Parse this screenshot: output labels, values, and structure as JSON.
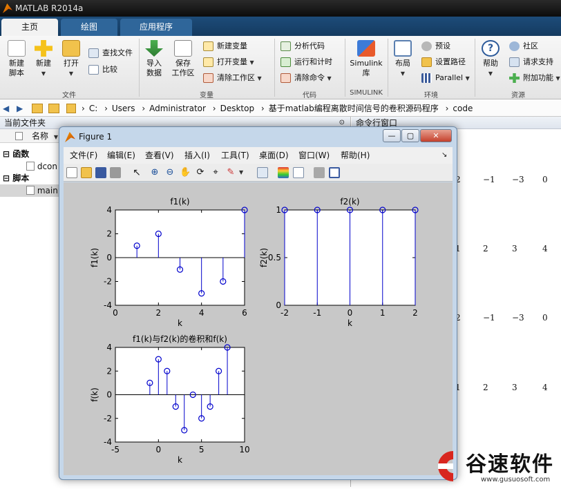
{
  "app": {
    "title": "MATLAB R2014a",
    "tabs": [
      "主页",
      "绘图",
      "应用程序"
    ]
  },
  "ribbon": {
    "file_group": {
      "label": "文件",
      "new_script": "新建\n脚本",
      "new": "新建",
      "open": "打开",
      "find_files": "查找文件",
      "compare": "比较"
    },
    "variable_group": {
      "label": "变量",
      "import": "导入\n数据",
      "save_workspace": "保存\n工作区",
      "new_variable": "新建变量",
      "open_variable": "打开变量",
      "clear_workspace": "清除工作区"
    },
    "code_group": {
      "label": "代码",
      "analyze": "分析代码",
      "run_and_time": "运行和计时",
      "clear_commands": "清除命令"
    },
    "simulink_group": {
      "label": "SIMULINK",
      "simulink": "Simulink\n库"
    },
    "environment_group": {
      "label": "环境",
      "layout": "布局",
      "preferences": "预设",
      "set_path": "设置路径",
      "parallel": "Parallel"
    },
    "resources_group": {
      "label": "资源",
      "help": "帮助",
      "community": "社区",
      "request_support": "请求支持",
      "addons": "附加功能"
    }
  },
  "address": {
    "segments": [
      "C:",
      "Users",
      "Administrator",
      "Desktop",
      "基于matlab编程离散时间信号的卷积源码程序",
      "code"
    ]
  },
  "current_folder": {
    "title": "当前文件夹",
    "name_column": "名称",
    "functions_label": "函数",
    "function_file": "dcon",
    "scripts_label": "脚本",
    "script_file": "main"
  },
  "command_window": {
    "title": "命令行窗口",
    "rows": [
      [
        "2",
        "−1",
        "−3",
        "0"
      ],
      [
        "1",
        "2",
        "3",
        "4"
      ],
      [
        "2",
        "−1",
        "−3",
        "0"
      ],
      [
        "1",
        "2",
        "3",
        "4"
      ]
    ]
  },
  "figure": {
    "title": "Figure 1",
    "menu": [
      "文件(F)",
      "编辑(E)",
      "查看(V)",
      "插入(I)",
      "工具(T)",
      "桌面(D)",
      "窗口(W)",
      "帮助(H)"
    ]
  },
  "chart_data": [
    {
      "type": "stem",
      "title": "f1(k)",
      "xlabel": "k",
      "ylabel": "f1(k)",
      "xlim": [
        0,
        6
      ],
      "ylim": [
        -4,
        4
      ],
      "xticks": [
        0,
        2,
        4,
        6
      ],
      "yticks": [
        -4,
        -2,
        0,
        2,
        4
      ],
      "x": [
        1,
        2,
        3,
        4,
        5,
        6
      ],
      "y": [
        1,
        2,
        -1,
        -3,
        -2,
        4
      ],
      "color": "#0000cc"
    },
    {
      "type": "stem",
      "title": "f2(k)",
      "xlabel": "k",
      "ylabel": "f2(k)",
      "xlim": [
        -2,
        2
      ],
      "ylim": [
        0,
        1
      ],
      "xticks": [
        -2,
        -1,
        0,
        1,
        2
      ],
      "yticks": [
        0,
        0.5,
        1
      ],
      "x": [
        -2,
        -1,
        0,
        1,
        2
      ],
      "y": [
        1,
        1,
        1,
        1,
        1
      ],
      "color": "#0000cc"
    },
    {
      "type": "stem",
      "title": "f1(k)与f2(k)的卷积和f(k)",
      "xlabel": "k",
      "ylabel": "f(k)",
      "xlim": [
        -5,
        10
      ],
      "ylim": [
        -4,
        4
      ],
      "xticks": [
        -5,
        0,
        5,
        10
      ],
      "yticks": [
        -4,
        -2,
        0,
        2,
        4
      ],
      "x": [
        -1,
        0,
        1,
        2,
        3,
        4,
        5,
        6,
        7,
        8
      ],
      "y": [
        1,
        3,
        2,
        -1,
        -3,
        0,
        -2,
        -1,
        2,
        4
      ],
      "color": "#0000cc"
    }
  ],
  "watermark": {
    "brand": "谷速软件",
    "url": "www.gusuosoft.com",
    "color": "#d8261f"
  }
}
